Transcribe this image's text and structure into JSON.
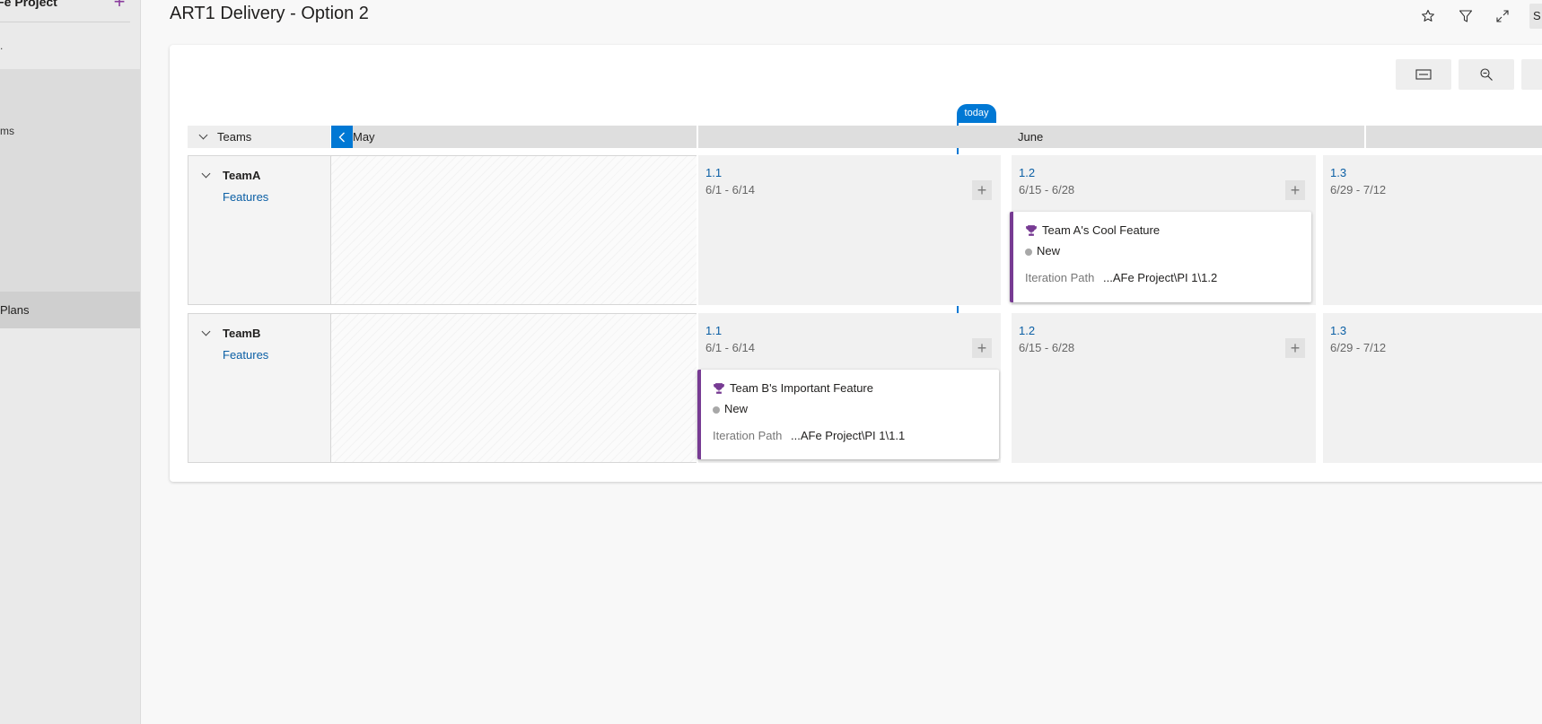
{
  "nav": {
    "project": "AFe Project",
    "row1": ".",
    "item_ms": "ms",
    "item_plans": "Plans"
  },
  "header": {
    "title": "ART1 Delivery - Option 2",
    "cut_button": "S"
  },
  "timeline": {
    "today_label": "today",
    "teams_label": "Teams",
    "months": [
      "May",
      "June"
    ]
  },
  "teams": [
    {
      "name": "TeamA",
      "backlog": "Features",
      "iterations": [
        {
          "name": "1.1",
          "dates": "6/1 - 6/14"
        },
        {
          "name": "1.2",
          "dates": "6/15 - 6/28"
        },
        {
          "name": "1.3",
          "dates": "6/29 - 7/12"
        }
      ],
      "card": {
        "title": "Team A's Cool Feature",
        "state": "New",
        "field_label": "Iteration Path",
        "field_value": "...AFe Project\\PI 1\\1.2"
      }
    },
    {
      "name": "TeamB",
      "backlog": "Features",
      "iterations": [
        {
          "name": "1.1",
          "dates": "6/1 - 6/14"
        },
        {
          "name": "1.2",
          "dates": "6/15 - 6/28"
        },
        {
          "name": "1.3",
          "dates": "6/29 - 7/12"
        }
      ],
      "card": {
        "title": "Team B's Important Feature",
        "state": "New",
        "field_label": "Iteration Path",
        "field_value": "...AFe Project\\PI 1\\1.1"
      }
    }
  ],
  "colors": {
    "accent": "#0078d4",
    "feature": "#773b93",
    "link": "#0b5fa5"
  }
}
